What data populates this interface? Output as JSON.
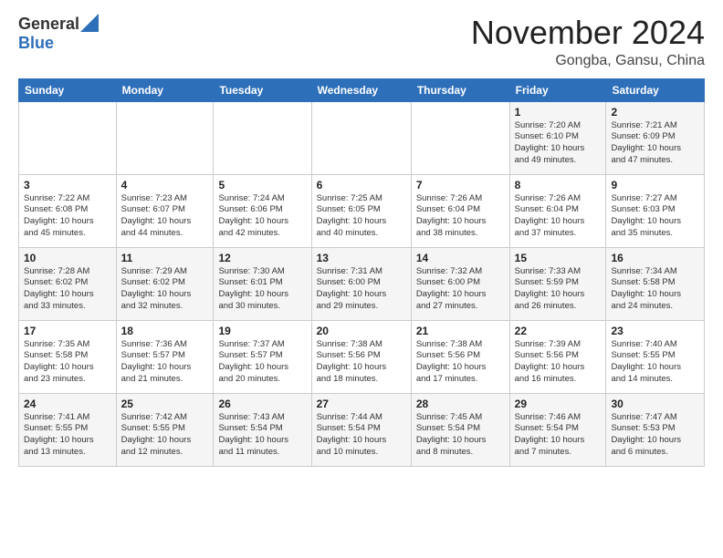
{
  "header": {
    "logo_general": "General",
    "logo_blue": "Blue",
    "month_title": "November 2024",
    "location": "Gongba, Gansu, China"
  },
  "weekdays": [
    "Sunday",
    "Monday",
    "Tuesday",
    "Wednesday",
    "Thursday",
    "Friday",
    "Saturday"
  ],
  "weeks": [
    [
      {
        "day": "",
        "info": ""
      },
      {
        "day": "",
        "info": ""
      },
      {
        "day": "",
        "info": ""
      },
      {
        "day": "",
        "info": ""
      },
      {
        "day": "",
        "info": ""
      },
      {
        "day": "1",
        "info": "Sunrise: 7:20 AM\nSunset: 6:10 PM\nDaylight: 10 hours\nand 49 minutes."
      },
      {
        "day": "2",
        "info": "Sunrise: 7:21 AM\nSunset: 6:09 PM\nDaylight: 10 hours\nand 47 minutes."
      }
    ],
    [
      {
        "day": "3",
        "info": "Sunrise: 7:22 AM\nSunset: 6:08 PM\nDaylight: 10 hours\nand 45 minutes."
      },
      {
        "day": "4",
        "info": "Sunrise: 7:23 AM\nSunset: 6:07 PM\nDaylight: 10 hours\nand 44 minutes."
      },
      {
        "day": "5",
        "info": "Sunrise: 7:24 AM\nSunset: 6:06 PM\nDaylight: 10 hours\nand 42 minutes."
      },
      {
        "day": "6",
        "info": "Sunrise: 7:25 AM\nSunset: 6:05 PM\nDaylight: 10 hours\nand 40 minutes."
      },
      {
        "day": "7",
        "info": "Sunrise: 7:26 AM\nSunset: 6:04 PM\nDaylight: 10 hours\nand 38 minutes."
      },
      {
        "day": "8",
        "info": "Sunrise: 7:26 AM\nSunset: 6:04 PM\nDaylight: 10 hours\nand 37 minutes."
      },
      {
        "day": "9",
        "info": "Sunrise: 7:27 AM\nSunset: 6:03 PM\nDaylight: 10 hours\nand 35 minutes."
      }
    ],
    [
      {
        "day": "10",
        "info": "Sunrise: 7:28 AM\nSunset: 6:02 PM\nDaylight: 10 hours\nand 33 minutes."
      },
      {
        "day": "11",
        "info": "Sunrise: 7:29 AM\nSunset: 6:02 PM\nDaylight: 10 hours\nand 32 minutes."
      },
      {
        "day": "12",
        "info": "Sunrise: 7:30 AM\nSunset: 6:01 PM\nDaylight: 10 hours\nand 30 minutes."
      },
      {
        "day": "13",
        "info": "Sunrise: 7:31 AM\nSunset: 6:00 PM\nDaylight: 10 hours\nand 29 minutes."
      },
      {
        "day": "14",
        "info": "Sunrise: 7:32 AM\nSunset: 6:00 PM\nDaylight: 10 hours\nand 27 minutes."
      },
      {
        "day": "15",
        "info": "Sunrise: 7:33 AM\nSunset: 5:59 PM\nDaylight: 10 hours\nand 26 minutes."
      },
      {
        "day": "16",
        "info": "Sunrise: 7:34 AM\nSunset: 5:58 PM\nDaylight: 10 hours\nand 24 minutes."
      }
    ],
    [
      {
        "day": "17",
        "info": "Sunrise: 7:35 AM\nSunset: 5:58 PM\nDaylight: 10 hours\nand 23 minutes."
      },
      {
        "day": "18",
        "info": "Sunrise: 7:36 AM\nSunset: 5:57 PM\nDaylight: 10 hours\nand 21 minutes."
      },
      {
        "day": "19",
        "info": "Sunrise: 7:37 AM\nSunset: 5:57 PM\nDaylight: 10 hours\nand 20 minutes."
      },
      {
        "day": "20",
        "info": "Sunrise: 7:38 AM\nSunset: 5:56 PM\nDaylight: 10 hours\nand 18 minutes."
      },
      {
        "day": "21",
        "info": "Sunrise: 7:38 AM\nSunset: 5:56 PM\nDaylight: 10 hours\nand 17 minutes."
      },
      {
        "day": "22",
        "info": "Sunrise: 7:39 AM\nSunset: 5:56 PM\nDaylight: 10 hours\nand 16 minutes."
      },
      {
        "day": "23",
        "info": "Sunrise: 7:40 AM\nSunset: 5:55 PM\nDaylight: 10 hours\nand 14 minutes."
      }
    ],
    [
      {
        "day": "24",
        "info": "Sunrise: 7:41 AM\nSunset: 5:55 PM\nDaylight: 10 hours\nand 13 minutes."
      },
      {
        "day": "25",
        "info": "Sunrise: 7:42 AM\nSunset: 5:55 PM\nDaylight: 10 hours\nand 12 minutes."
      },
      {
        "day": "26",
        "info": "Sunrise: 7:43 AM\nSunset: 5:54 PM\nDaylight: 10 hours\nand 11 minutes."
      },
      {
        "day": "27",
        "info": "Sunrise: 7:44 AM\nSunset: 5:54 PM\nDaylight: 10 hours\nand 10 minutes."
      },
      {
        "day": "28",
        "info": "Sunrise: 7:45 AM\nSunset: 5:54 PM\nDaylight: 10 hours\nand 8 minutes."
      },
      {
        "day": "29",
        "info": "Sunrise: 7:46 AM\nSunset: 5:54 PM\nDaylight: 10 hours\nand 7 minutes."
      },
      {
        "day": "30",
        "info": "Sunrise: 7:47 AM\nSunset: 5:53 PM\nDaylight: 10 hours\nand 6 minutes."
      }
    ]
  ]
}
